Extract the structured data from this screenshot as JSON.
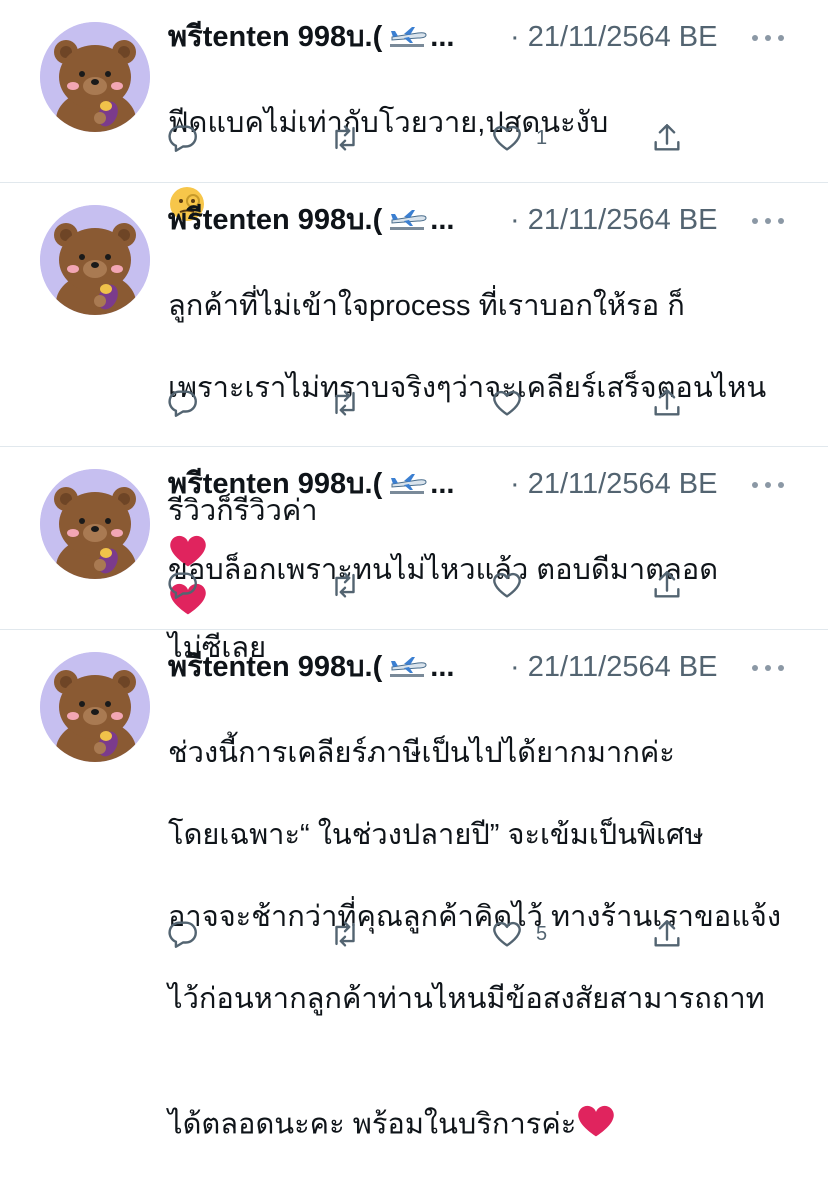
{
  "tweets": [
    {
      "name": "พรีtenten 998บ.(",
      "name_tail": "...",
      "date": "· 21/11/2564 BE",
      "text": "ฟีดแบคไม่เท่ากับโวยวาย,ปสดนะงับ",
      "trailing_emoji": "face-with-monocle",
      "reply_count": "",
      "retweet_count": "",
      "like_count": "1"
    },
    {
      "name": "พรีtenten 998บ.(",
      "name_tail": "...",
      "date": "· 21/11/2564 BE",
      "text_lines": [
        "ลูกค้าที่ไม่เข้าใจprocess ที่เราบอกให้รอ ก็",
        "เพราะเราไม่ทราบจริงๆว่าจะเคลียร์เสร็จตอนไหน"
      ],
      "text_last_prefix": "รีวิวก็รีวิวค่า",
      "text_last_suffix": "ไม่ซีเลย",
      "reply_count": "",
      "retweet_count": "",
      "like_count": ""
    },
    {
      "name": "พรีtenten 998บ.(",
      "name_tail": "...",
      "date": "· 21/11/2564 BE",
      "text": "ขอบล็อกเพราะทนไม่ไหวแล้ว ตอบดีมาตลอด",
      "reply_count": "",
      "retweet_count": "",
      "like_count": ""
    },
    {
      "name": "พรีtenten 998บ.(",
      "name_tail": "...",
      "date": "· 21/11/2564 BE",
      "text_lines": [
        "ช่วงนี้การเคลียร์ภาษีเป็นไปได้ยากมากค่ะ",
        "โดยเฉพาะ“ ในช่วงปลายปี” จะเข้มเป็นพิเศษ",
        "อาจจะช้ากว่าที่คุณลูกค้าคิดไว้ ทางร้านเราขอแจ้ง",
        "ไว้ก่อนหากลูกค้าท่านไหนมีข้อสงสัยสามารถถาท"
      ],
      "text_last_prefix": "ได้ตลอดนะคะ พร้อมในบริการค่ะ",
      "reply_count": "",
      "retweet_count": "",
      "like_count": "5"
    }
  ],
  "colors": {
    "text": "#0f1419",
    "secondary": "#536471",
    "divider": "#e1e8ed",
    "avatar_bg": "#c6bff0",
    "bear": "#8a5a33",
    "heart": "#e0245e"
  },
  "icons": {
    "reply": "reply-icon",
    "retweet": "retweet-icon",
    "like": "like-icon",
    "share": "share-icon",
    "more": "more-icon",
    "airplane": "airplane-emoji-icon"
  }
}
